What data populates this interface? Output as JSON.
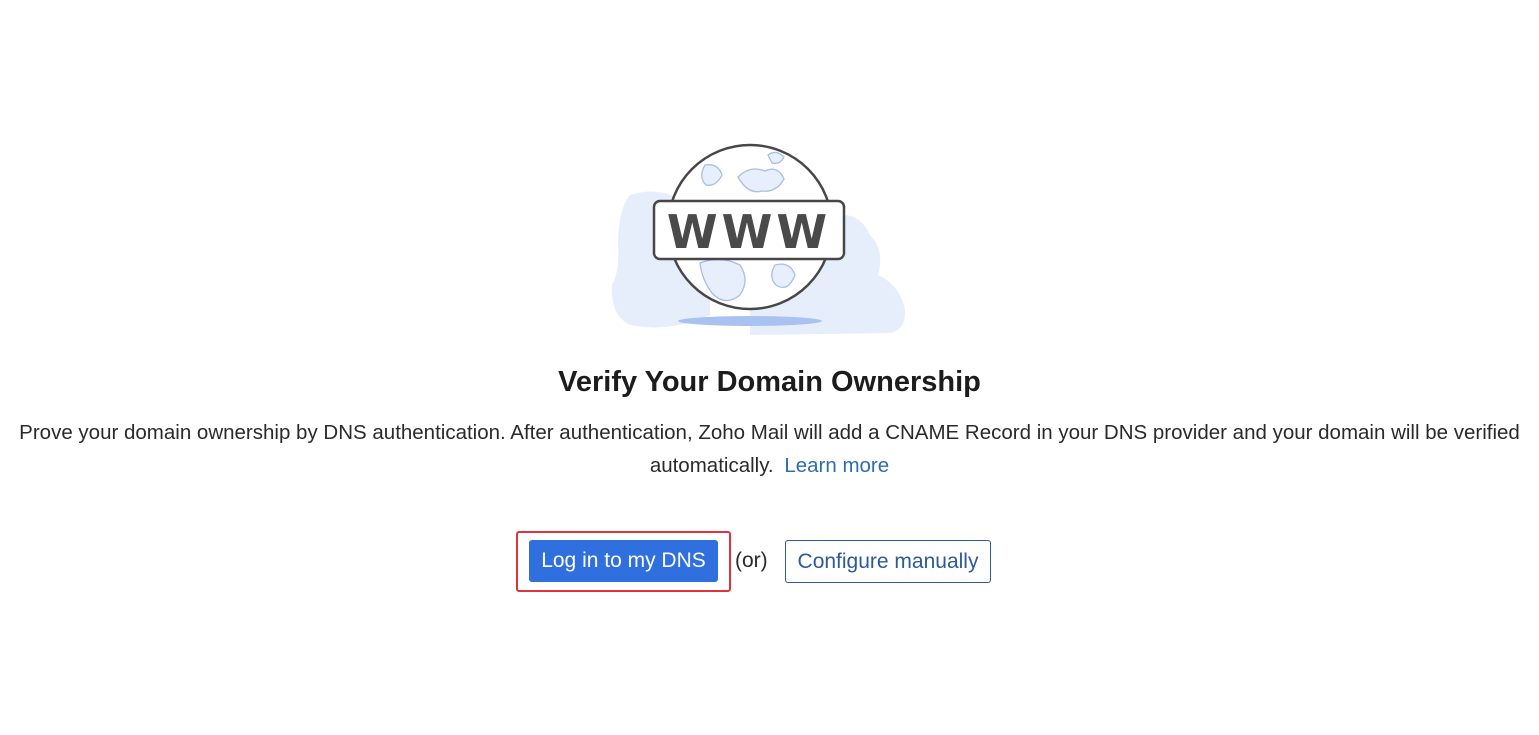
{
  "illustration": {
    "icon": "globe-www-icon",
    "label": "WWW"
  },
  "heading": {
    "title": "Verify Your Domain Ownership"
  },
  "description": {
    "text": "Prove your domain ownership by DNS authentication. After authentication, Zoho Mail will add a CNAME Record in your DNS provider and your domain will be verified automatically.",
    "learn_more": "Learn more"
  },
  "actions": {
    "primary_label": "Log in to my DNS",
    "separator": "(or)",
    "secondary_label": "Configure manually"
  },
  "colors": {
    "primary": "#2f6fde",
    "link": "#2d6cb5",
    "highlight": "#e0323b"
  }
}
